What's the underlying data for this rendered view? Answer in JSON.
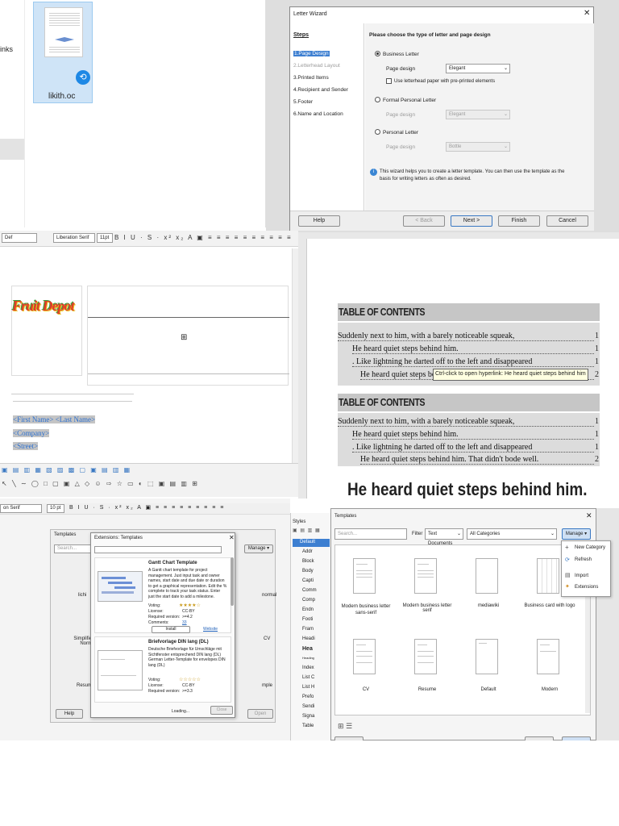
{
  "file_browser": {
    "side_text": "inks",
    "file_name": "likith.oc"
  },
  "letter_wizard": {
    "title": "Letter Wizard",
    "steps_heading": "Steps",
    "steps": [
      "1.Page Design",
      "2.Letterhead Layout",
      "3.Printed Items",
      "4.Recipient and Sender",
      "5.Footer",
      "6.Name and Location"
    ],
    "heading": "Please choose the type of letter and page design",
    "business_letter": "Business Letter",
    "page_design_label": "Page design",
    "business_design": "Elegant",
    "letterhead_checkbox": "Use letterhead paper with pre-printed elements",
    "formal_letter": "Formal Personal Letter",
    "formal_design": "Elegant",
    "personal_letter": "Personal Letter",
    "personal_design": "Bottle",
    "info_text": "This wizard helps you to create a letter template. You can then use the template as the basis for writing letters as often as desired.",
    "help": "Help",
    "back": "< Back",
    "next": "Next >",
    "finish": "Finish",
    "cancel": "Cancel"
  },
  "writer_doc": {
    "para_style": "Def",
    "font": "Liberation Serif",
    "size": "11pt",
    "logo_text": "Fruit Depot",
    "fields": [
      "<First Name> <Last Name>",
      "<Company>",
      "<Street>"
    ]
  },
  "toc_doc": {
    "heading1": "TABLE OF CONTENTS",
    "entries1": [
      {
        "text": "Suddenly next to him, with a barely noticeable squeak,",
        "page": "1"
      },
      {
        "text": "He heard quiet steps behind him.",
        "page": "1"
      },
      {
        "text": ". Like lightning he darted off to the left and disappeared",
        "page": "1"
      },
      {
        "text": "He heard quiet steps behind",
        "page": "2"
      }
    ],
    "tooltip": "Ctrl-click to open hyperlink: He heard quiet steps behind him",
    "heading2": "TABLE OF CONTENTS",
    "entries2": [
      {
        "text": "Suddenly next to him, with a barely noticeable squeak,",
        "page": "1"
      },
      {
        "text": "He heard quiet steps behind him.",
        "page": "1"
      },
      {
        "text": ". Like lightning he darted off to the left and disappeared",
        "page": "1"
      },
      {
        "text": "He heard quiet steps behind him. That didn't bode well.",
        "page": "2"
      }
    ],
    "big_heading": "He heard quiet steps behind him."
  },
  "extensions_shot": {
    "font": "on Serif",
    "size": "10 pt",
    "templates_title": "Templates",
    "search": "Search...",
    "manage": "Manage",
    "dialog_title": "Extensions: Templates",
    "ext1": {
      "title": "Gantt Chart Template",
      "desc": "A Gantt chart template for project management. Just input task and owner names, start date and due date or duration to get a graphical representation. Edit the % complete to track your task status. Enter just the start date to add a milestone.",
      "voting_label": "Voting:",
      "license_label": "License:",
      "license": "CC-BY",
      "required_label": "Required version:",
      "required": ">=4.2",
      "comments_label": "Comments:",
      "comments": "33",
      "install": "Install",
      "website": "Website"
    },
    "ext2": {
      "title": "Briefvorlage DIN lang (DL)",
      "desc": "Deutsche Briefvorlage für Umschläge mit Sichtfenster entsprechend DIN lang (DL) German Letter-Template for envelopes DIN lang (DL)",
      "voting_label": "Voting:",
      "license_label": "License:",
      "license": "CC-BY",
      "required_label": "Required version:",
      "required": ">=3.3"
    },
    "loading": "Loading...",
    "close": "Close",
    "bg_items": [
      "lichi",
      "normal",
      "Simplified Ch Normal",
      "CV",
      "Resume",
      "mple"
    ],
    "help": "Help",
    "open": "Open"
  },
  "styles_panel": {
    "title": "Styles",
    "items": [
      "Default",
      "Addr",
      "Block",
      "Body",
      "Capti",
      "Comm",
      "Comp",
      "Endn",
      "Footi",
      "Fram",
      "Headi",
      "Hea",
      "Heading",
      "Index",
      "List C",
      "List H",
      "Prefo",
      "Sendi",
      "Signa",
      "Table"
    ]
  },
  "templates_dialog": {
    "title": "Templates",
    "search": "Search...",
    "filter_label": "Filter",
    "filter": "Text Documents",
    "category": "All Categories",
    "manage": "Manage",
    "menu": [
      "New Category",
      "Refresh",
      "Import",
      "Extensions"
    ],
    "templates": [
      "Modern business letter sans-serif",
      "Modern business letter serif",
      "mediawiki",
      "Business card with logo",
      "CV",
      "Resume",
      "Default",
      "Modern"
    ]
  }
}
